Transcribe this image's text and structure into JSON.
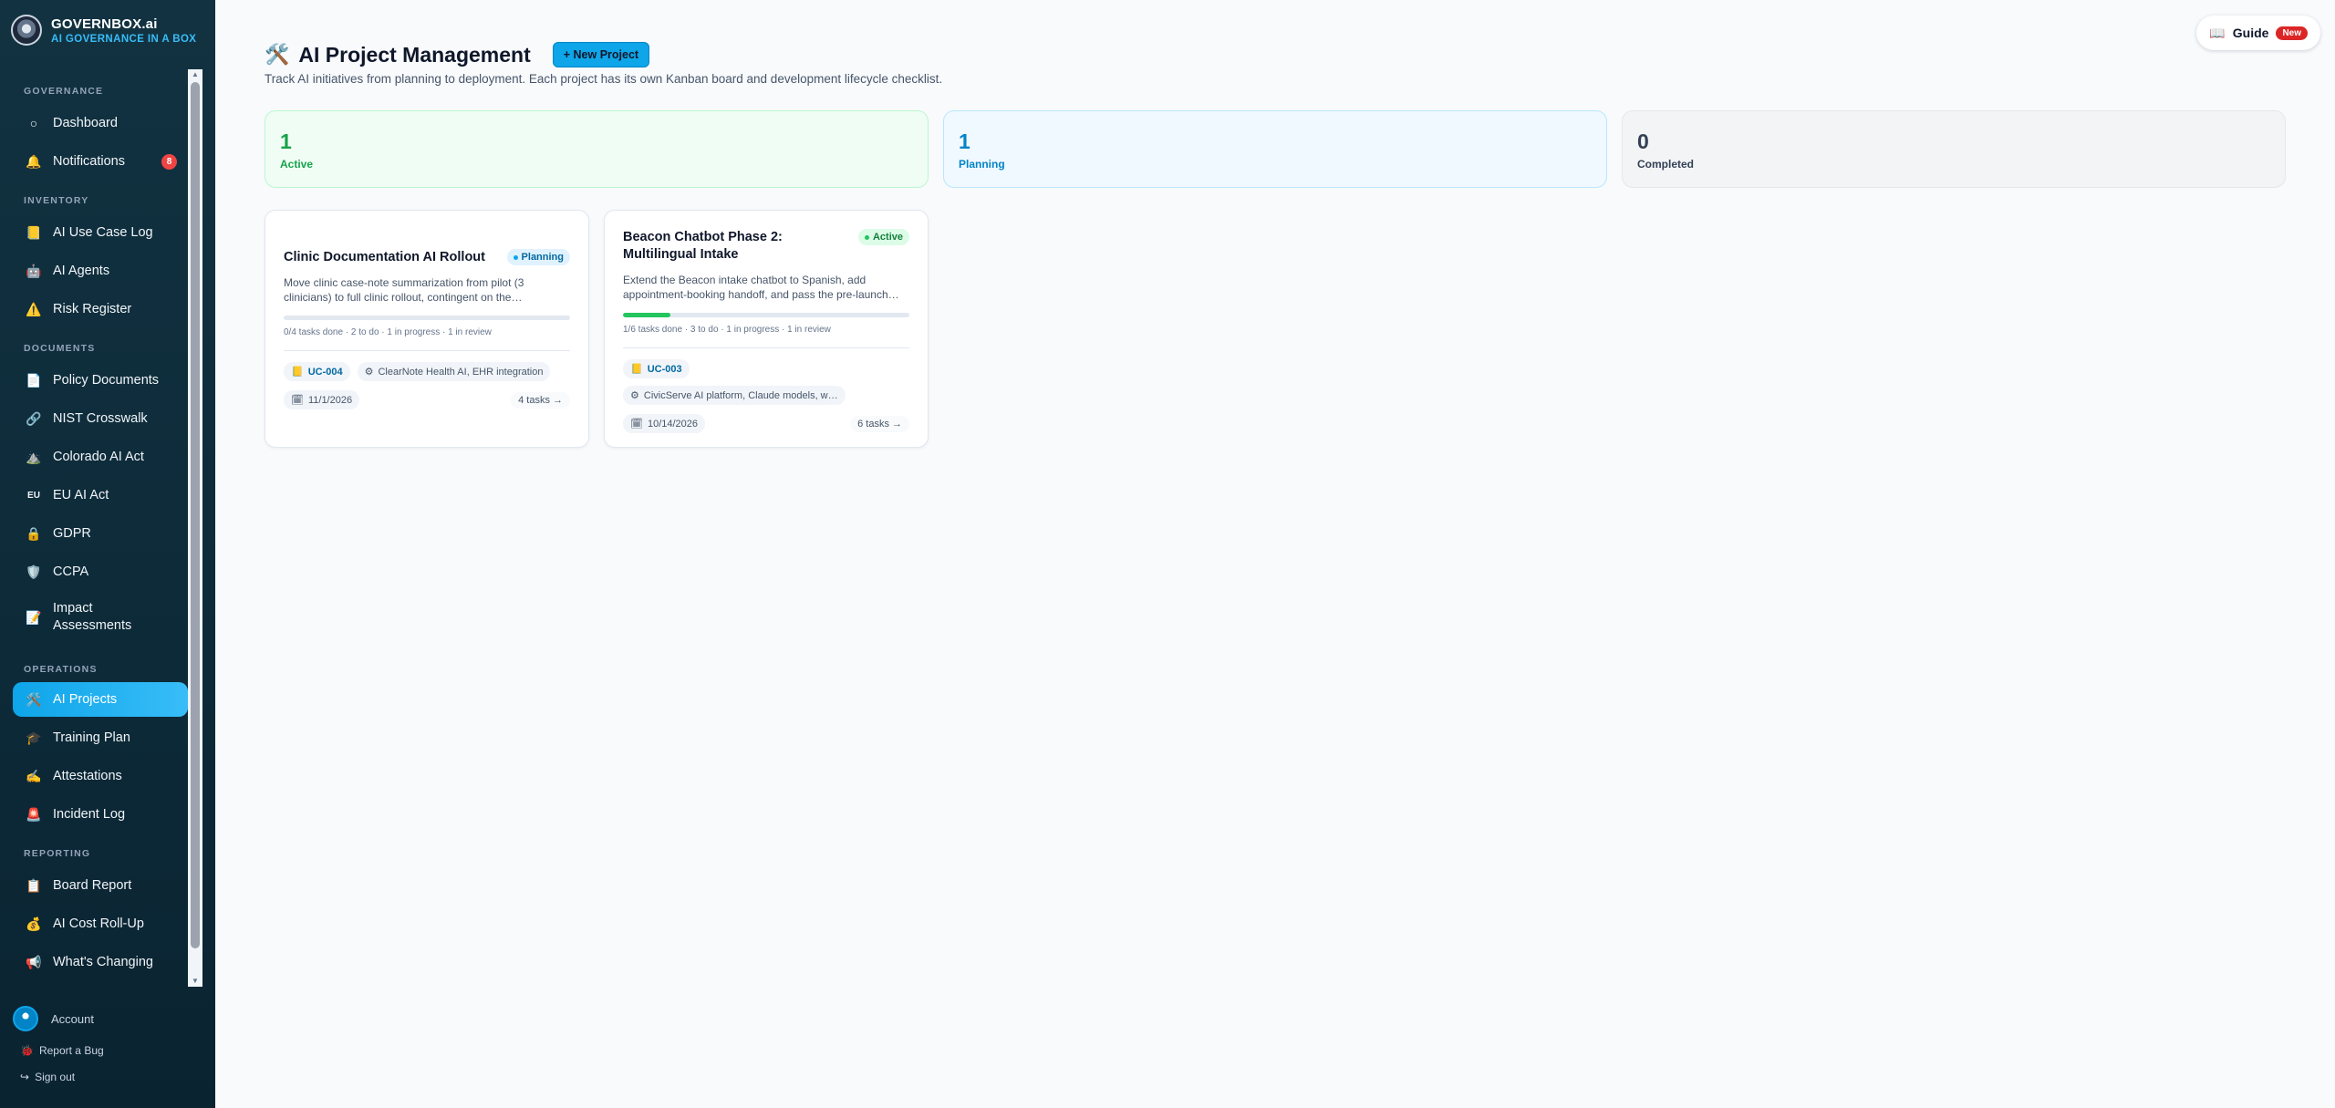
{
  "brand": {
    "name": "GOVERNBOX.ai",
    "tagline": "AI GOVERNANCE IN A BOX"
  },
  "sidebar": {
    "sections": {
      "governance": "GOVERNANCE",
      "inventory": "INVENTORY",
      "documents": "DOCUMENTS",
      "operations": "OPERATIONS",
      "reporting": "REPORTING"
    },
    "items": {
      "dashboard": "Dashboard",
      "notifications": "Notifications",
      "notifications_count": "8",
      "use_case_log": "AI Use Case Log",
      "agents": "AI Agents",
      "risk_register": "Risk Register",
      "policy_documents": "Policy Documents",
      "nist_crosswalk": "NIST Crosswalk",
      "colorado": "Colorado AI Act",
      "eu_prefix": "EU",
      "eu": "EU AI Act",
      "gdpr": "GDPR",
      "ccpa": "CCPA",
      "impact_1": "Impact",
      "impact_2": "Assessments",
      "projects": "AI Projects",
      "training": "Training Plan",
      "attestations": "Attestations",
      "incident": "Incident Log",
      "board_report": "Board Report",
      "cost_rollup": "AI Cost Roll-Up",
      "whats_changing": "What's Changing"
    },
    "footer": {
      "account": "Account",
      "report_bug": "Report a Bug",
      "sign_out": "Sign out"
    }
  },
  "header": {
    "title": "AI Project Management",
    "new_project": "+ New Project",
    "subtitle": "Track AI initiatives from planning to deployment. Each project has its own Kanban board and development lifecycle checklist.",
    "guide": "Guide",
    "guide_badge": "New"
  },
  "stats": {
    "active": {
      "value": "1",
      "label": "Active"
    },
    "planning": {
      "value": "1",
      "label": "Planning"
    },
    "completed": {
      "value": "0",
      "label": "Completed"
    }
  },
  "projects": [
    {
      "title": "Clinic Documentation AI Rollout",
      "status": "Planning",
      "description": "Move clinic case-note summarization from pilot (3 clinicians) to full clinic rollout, contingent on the…",
      "progress": 0,
      "tasks_summary": "0/4 tasks done · 2 to do · 1 in progress · 1 in review",
      "use_case": "UC-004",
      "vendor": "ClearNote Health AI, EHR integration",
      "date": "11/1/2026",
      "tasks_link": "4 tasks →"
    },
    {
      "title": "Beacon Chatbot Phase 2: Multilingual Intake",
      "status": "Active",
      "description": "Extend the Beacon intake chatbot to Spanish, add appointment-booking handoff, and pass the pre-launch…",
      "progress": 0.1667,
      "tasks_summary": "1/6 tasks done · 3 to do · 1 in progress · 1 in review",
      "use_case": "UC-003",
      "vendor": "CivicServe AI platform, Claude models, w…",
      "date": "10/14/2026",
      "tasks_link": "6 tasks →"
    }
  ],
  "colors": {
    "accent": "#0ea5e9",
    "active": "#16a34a",
    "planning": "#0284c7",
    "sidebar": "#123241"
  }
}
